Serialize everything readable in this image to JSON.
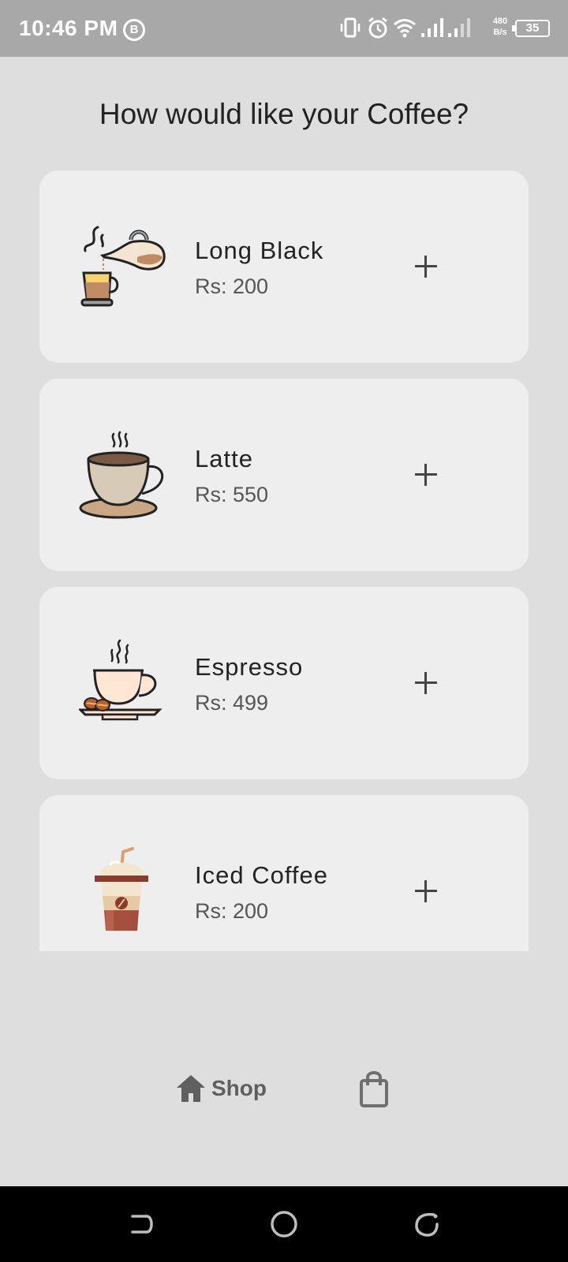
{
  "status_bar": {
    "time": "10:46 PM",
    "b_badge": "B",
    "net_speed_value": "480",
    "net_speed_unit": "B/s",
    "battery": "35",
    "icons": [
      "vibrate-icon",
      "alarm-icon",
      "wifi-icon",
      "signal-icon",
      "signal-icon"
    ]
  },
  "page": {
    "title": "How would like your Coffee?"
  },
  "coffees": [
    {
      "name": "Long Black",
      "price": "Rs: 200",
      "icon": "pour-coffee-icon"
    },
    {
      "name": "Latte",
      "price": "Rs: 550",
      "icon": "latte-cup-icon"
    },
    {
      "name": "Espresso",
      "price": "Rs: 499",
      "icon": "espresso-cup-icon"
    },
    {
      "name": "Iced Coffee",
      "price": "Rs: 200",
      "icon": "iced-coffee-icon"
    }
  ],
  "bottom_nav": {
    "shop_label": "Shop",
    "shop_icon": "home-icon",
    "cart_icon": "shopping-bag-icon"
  },
  "colors": {
    "background": "#dedede",
    "card": "#eeeeee",
    "status_bar": "#a8a8a8",
    "nav_icon": "#5f5f5f"
  }
}
